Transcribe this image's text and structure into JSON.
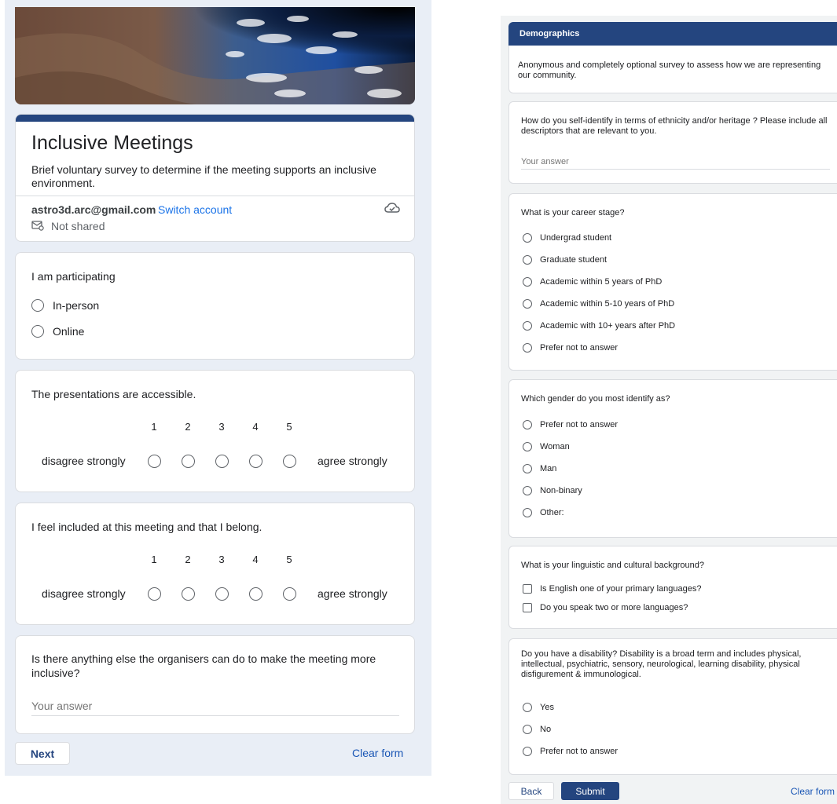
{
  "left_form": {
    "title": "Inclusive Meetings",
    "description": "Brief voluntary survey to determine if the meeting supports an inclusive environment.",
    "account": {
      "email": "astro3d.arc@gmail.com",
      "switch_label": "Switch account",
      "not_shared_label": "Not shared"
    },
    "q1": {
      "title": "I am participating",
      "options": [
        "In-person",
        "Online"
      ]
    },
    "q2": {
      "title": "The presentations are accessible.",
      "scale": [
        "1",
        "2",
        "3",
        "4",
        "5"
      ],
      "low_label": "disagree strongly",
      "high_label": "agree strongly"
    },
    "q3": {
      "title": "I feel included at this meeting and that I belong.",
      "scale": [
        "1",
        "2",
        "3",
        "4",
        "5"
      ],
      "low_label": "disagree strongly",
      "high_label": "agree strongly"
    },
    "q4": {
      "title": "Is there anything else the organisers can do to make the meeting more inclusive?",
      "placeholder": "Your answer"
    },
    "next_label": "Next",
    "clear_label": "Clear form"
  },
  "right_form": {
    "section_title": "Demographics",
    "section_description": "Anonymous and completely optional survey to assess how we are representing our community.",
    "q1": {
      "title": "How do you self-identify in terms of ethnicity and/or heritage ? Please include all descriptors that are relevant to you.",
      "placeholder": "Your answer"
    },
    "q2": {
      "title": "What is your career stage?",
      "options": [
        "Undergrad student",
        "Graduate student",
        "Academic within 5 years of PhD",
        "Academic within 5-10 years of PhD",
        "Academic with 10+ years after PhD",
        "Prefer not to answer"
      ]
    },
    "q3": {
      "title": "Which gender do you most identify as?",
      "options": [
        "Prefer not to answer",
        "Woman",
        "Man",
        "Non-binary",
        "Other:"
      ]
    },
    "q4": {
      "title": "What is your linguistic and cultural background?",
      "options": [
        "Is English one of your primary languages?",
        "Do you speak two or more languages?"
      ]
    },
    "q5": {
      "title": "Do you have a disability?  Disability is a broad term and includes physical, intellectual, psychiatric, sensory, neurological, learning disability, physical disfigurement & immunological.",
      "options": [
        "Yes",
        "No",
        "Prefer not to answer"
      ]
    },
    "back_label": "Back",
    "submit_label": "Submit",
    "clear_label": "Clear form"
  },
  "colors": {
    "theme": "#24457f",
    "link": "#1a73e8",
    "background": "#e9eef6"
  },
  "icons": [
    "cloud-check-icon",
    "not-shared-icon"
  ]
}
